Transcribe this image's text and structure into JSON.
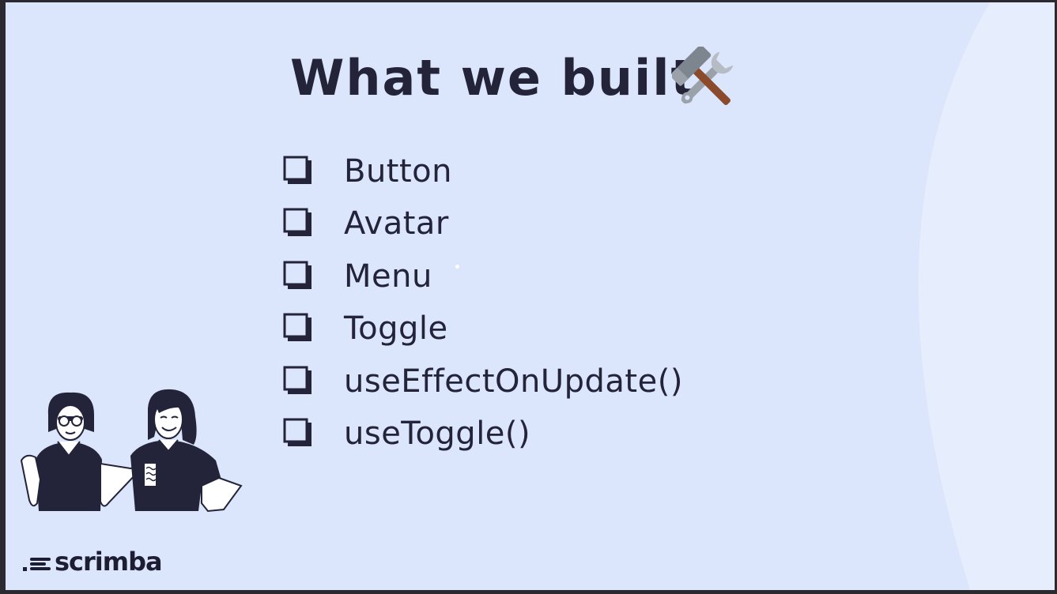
{
  "slide": {
    "title": "What we built",
    "title_icon": "hammer-and-wrench-icon",
    "checklist": [
      {
        "label": "Button",
        "icon": "checkbox-icon"
      },
      {
        "label": "Avatar",
        "icon": "checkbox-icon"
      },
      {
        "label": "Menu",
        "icon": "checkbox-icon"
      },
      {
        "label": "Toggle",
        "icon": "checkbox-icon"
      },
      {
        "label": "useEffectOnUpdate()",
        "icon": "checkbox-icon"
      },
      {
        "label": "useToggle()",
        "icon": "checkbox-icon"
      }
    ]
  },
  "brand": {
    "name": "scrimba",
    "icon": "scrimba-logo-icon"
  },
  "colors": {
    "background": "#dbe5fb",
    "text": "#23233a",
    "accent_curve": "#e6edfd"
  }
}
